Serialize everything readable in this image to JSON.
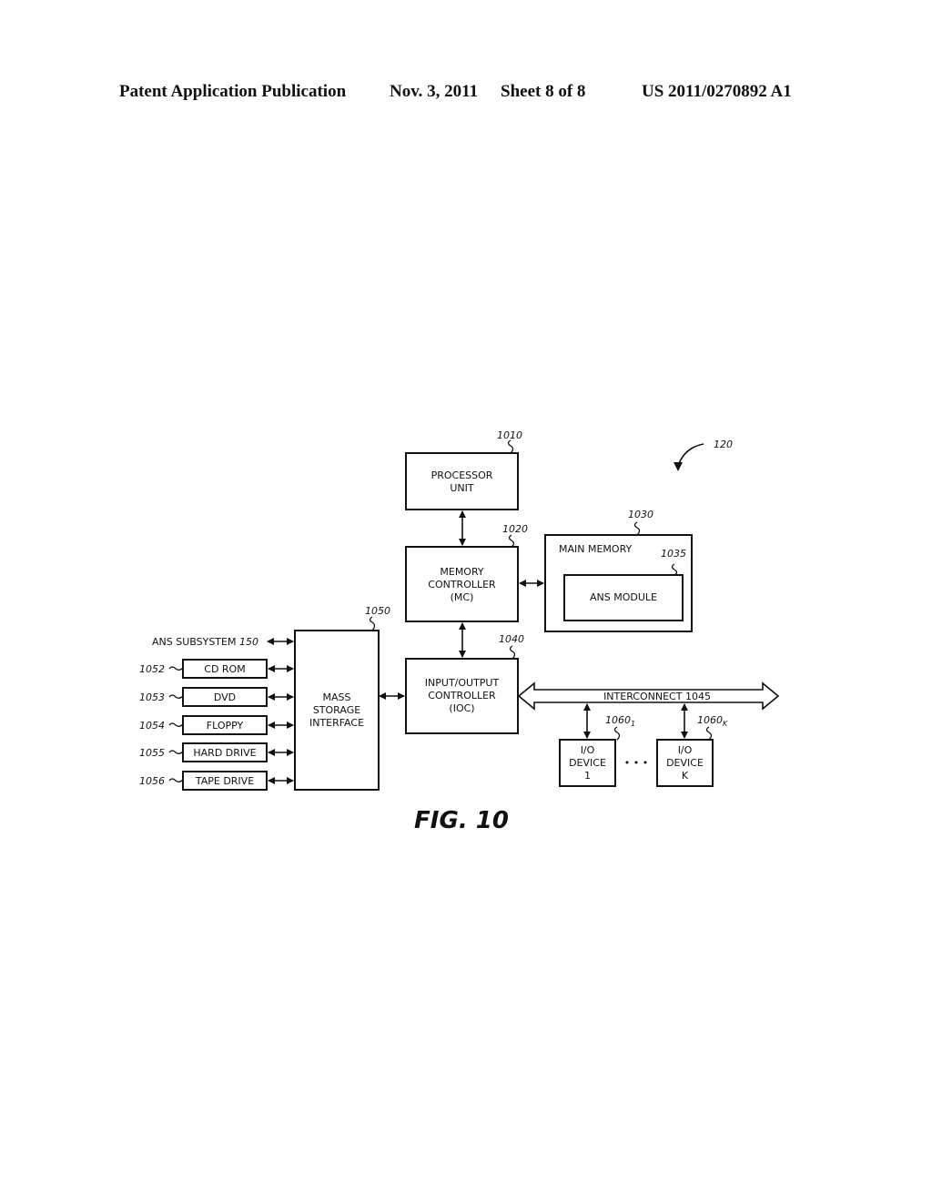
{
  "header": {
    "publication": "Patent Application Publication",
    "date": "Nov. 3, 2011",
    "sheet": "Sheet 8 of 8",
    "number": "US 2011/0270892 A1"
  },
  "figure": {
    "caption": "FIG. 10",
    "system_ref": "120",
    "processor": {
      "ref": "1010",
      "lines": [
        "PROCESSOR",
        "UNIT"
      ]
    },
    "memory_controller": {
      "ref": "1020",
      "lines": [
        "MEMORY",
        "CONTROLLER",
        "(MC)"
      ]
    },
    "main_memory": {
      "ref": "1030",
      "label": "MAIN MEMORY"
    },
    "ans_module": {
      "ref": "1035",
      "label": "ANS MODULE"
    },
    "io_controller": {
      "ref": "1040",
      "lines": [
        "INPUT/OUTPUT",
        "CONTROLLER",
        "(IOC)"
      ]
    },
    "interconnect": {
      "label": "INTERCONNECT 1045"
    },
    "mass_storage": {
      "ref": "1050",
      "lines": [
        "MASS",
        "STORAGE",
        "INTERFACE"
      ]
    },
    "ans_subsystem": {
      "label": "ANS SUBSYSTEM",
      "ref": "150"
    },
    "storage_devices": [
      {
        "ref": "1052",
        "label": "CD ROM"
      },
      {
        "ref": "1053",
        "label": "DVD"
      },
      {
        "ref": "1054",
        "label": "FLOPPY"
      },
      {
        "ref": "1055",
        "label": "HARD DRIVE"
      },
      {
        "ref": "1056",
        "label": "TAPE DRIVE"
      }
    ],
    "io_devices": [
      {
        "ref": "1060",
        "sub": "1",
        "lines": [
          "I/O",
          "DEVICE",
          "1"
        ]
      },
      {
        "ref": "1060",
        "sub": "K",
        "lines": [
          "I/O",
          "DEVICE",
          "K"
        ]
      }
    ],
    "ellipsis": "• • •"
  }
}
